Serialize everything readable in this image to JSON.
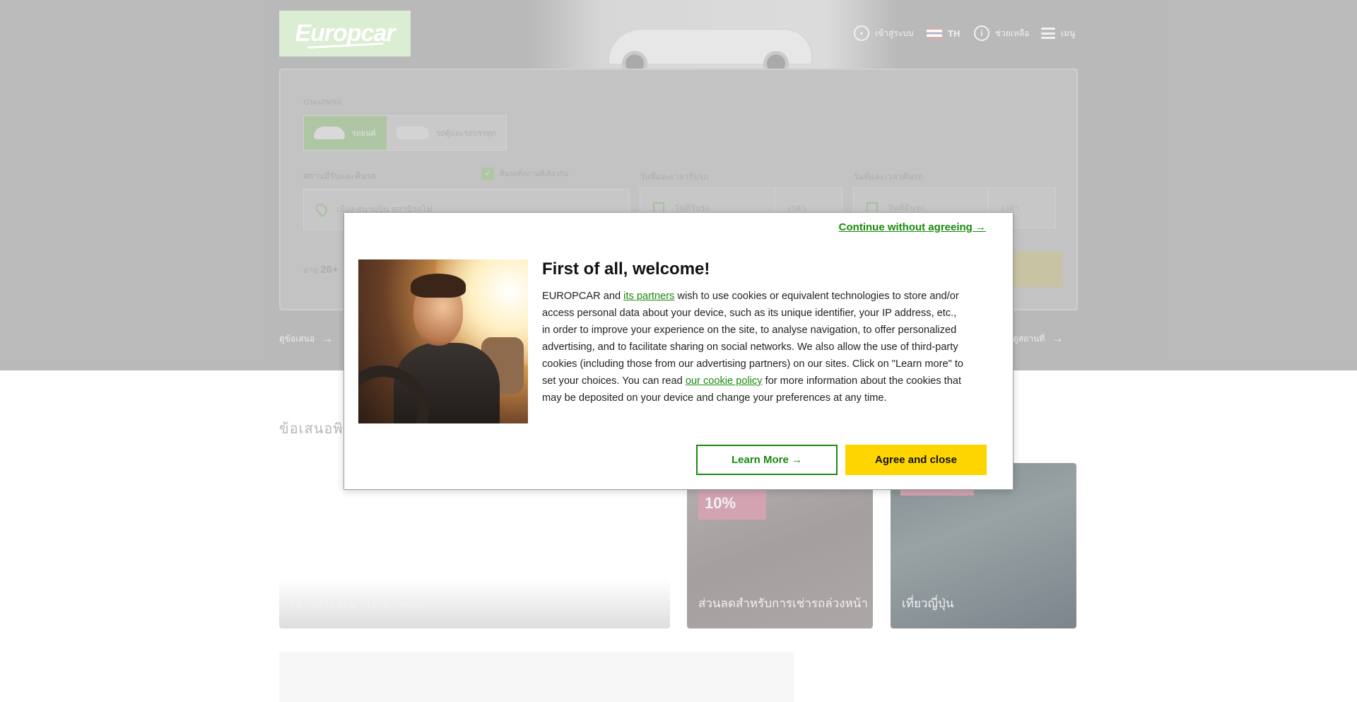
{
  "header": {
    "logo_text": "Europcar",
    "login_label": "เข้าสู่ระบบ",
    "language_code": "TH",
    "help_label": "ช่วยเหลือ",
    "menu_label": "เมนู"
  },
  "booking": {
    "vehicle_type_label": "ประเภทรถ",
    "vehicle_options": [
      {
        "label": "รถยนต์",
        "active": true
      },
      {
        "label": "รถตู้และรถบรรทุก",
        "active": false
      }
    ],
    "pickup_location_label": "สถานที่รับและคืนรถ",
    "same_return_label": "คืนรถที่สถานที่เดียวกัน",
    "pickup_location_placeholder": "เมือง สนามบิน สถานีรถไฟ",
    "pickup_date_label": "วันที่และเวลารับรถ",
    "pickup_date_placeholder": "วันที่รับรถ",
    "pickup_time_placeholder": "เวลา",
    "return_date_label": "วันที่และเวลาคืนรถ",
    "return_date_placeholder": "วันที่คืนรถ",
    "return_time_placeholder": "เวลา",
    "age_prefix": "อายุ",
    "age_value": "26+"
  },
  "quicklinks": {
    "left": "ดูข้อเสนอ",
    "right": "ดูสถานที่"
  },
  "offers": {
    "section_title": "ข้อเสนอพิเศษ",
    "cards": [
      {
        "caption": "เช่ารถระยะยาวราคาพิเศษ"
      },
      {
        "badge": "10%",
        "caption": "ส่วนลดสำหรับการเช่ารถล่วงหน้า"
      },
      {
        "caption": "เที่ยวญี่ปุ่น"
      }
    ]
  },
  "cookie_dialog": {
    "continue_without_agreeing": "Continue without agreeing →",
    "title": "First of all, welcome!",
    "body_part1": "EUROPCAR and ",
    "partners_link": "its partners",
    "body_part2": " wish to use cookies or equivalent technologies to store and/or access personal data about your device, such as its unique identifier, your IP address, etc., in order to improve your experience on the site, to analyse navigation, to offer personalized advertising, and to facilitate sharing on social networks. We also allow the use of third-party cookies (including those from our advertising partners) on our sites. Click on \"Learn more\" to set your choices. You can read ",
    "cookie_policy_link": "our cookie policy",
    "body_part3": " for more information about the cookies that may be deposited on your device and change your preferences at any time.",
    "learn_more_button": "Learn More →",
    "agree_button": "Agree and close"
  },
  "colors": {
    "brand_green": "#1a8a0e",
    "agree_yellow": "#ffd500"
  }
}
